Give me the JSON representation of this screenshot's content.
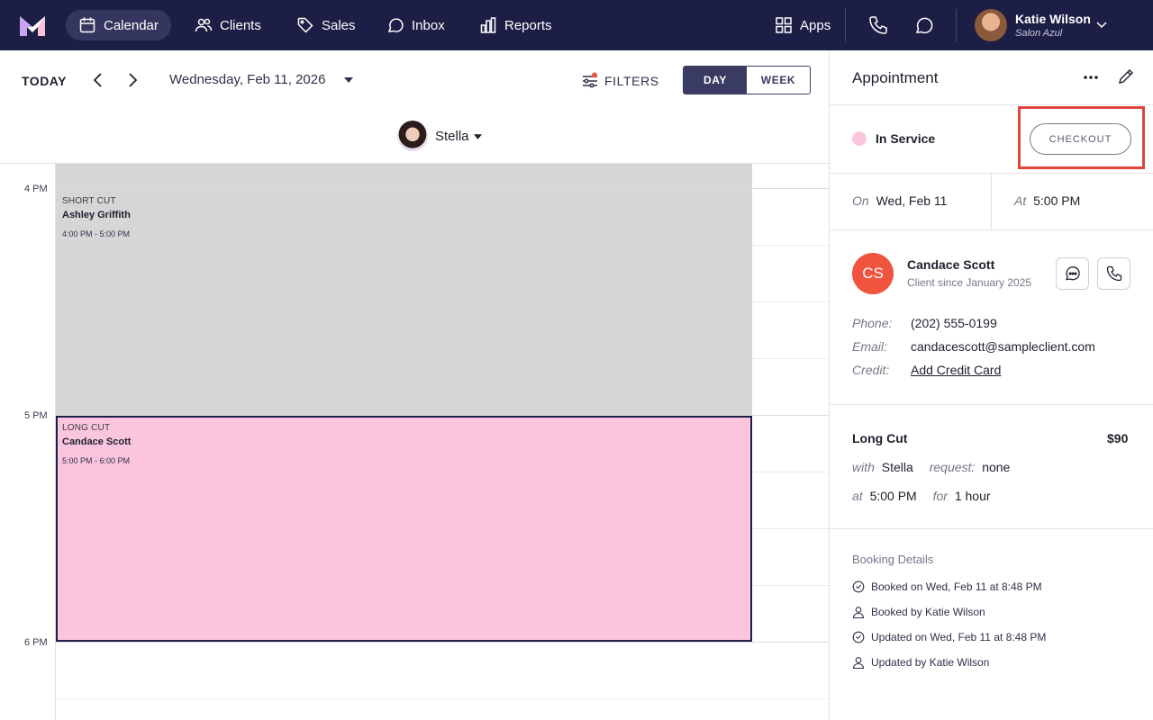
{
  "nav": {
    "items": [
      {
        "label": "Calendar",
        "icon": "calendar-icon",
        "active": true
      },
      {
        "label": "Clients",
        "icon": "clients-icon"
      },
      {
        "label": "Sales",
        "icon": "tag-icon"
      },
      {
        "label": "Inbox",
        "icon": "inbox-icon"
      },
      {
        "label": "Reports",
        "icon": "chart-icon"
      }
    ],
    "apps_label": "Apps",
    "user": {
      "name": "Katie Wilson",
      "salon": "Salon Azul"
    }
  },
  "calendar": {
    "today_label": "TODAY",
    "date": "Wednesday, Feb 11, 2026",
    "filters_label": "FILTERS",
    "view": {
      "day": "DAY",
      "week": "WEEK",
      "selected": "DAY"
    },
    "staff": "Stella",
    "hours": [
      "4 PM",
      "5 PM",
      "6 PM"
    ],
    "appointments": [
      {
        "service": "SHORT CUT",
        "client": "Ashley Griffith",
        "time": "4:00 PM - 5:00 PM",
        "color": "#d6d6d6"
      },
      {
        "service": "LONG CUT",
        "client": "Candace Scott",
        "time": "5:00 PM - 6:00 PM",
        "color": "#fbc6dd",
        "selected": true
      }
    ]
  },
  "panel": {
    "title": "Appointment",
    "status": "In Service",
    "status_color": "#fbc6dd",
    "checkout_label": "CHECKOUT",
    "on_label": "On",
    "on_value": "Wed, Feb 11",
    "at_label": "At",
    "at_value": "5:00 PM",
    "client": {
      "initials": "CS",
      "name": "Candace Scott",
      "since": "Client since January 2025",
      "avatar_color": "#f0533e",
      "phone_label": "Phone:",
      "phone": "(202) 555-0199",
      "email_label": "Email:",
      "email": "candacescott@sampleclient.com",
      "credit_label": "Credit:",
      "credit_link": "Add Credit Card"
    },
    "service": {
      "name": "Long Cut",
      "price": "$90",
      "with_label": "with",
      "with": "Stella",
      "request_label": "request:",
      "request": "none",
      "at_label": "at",
      "at": "5:00 PM",
      "for_label": "for",
      "duration": "1 hour"
    },
    "booking": {
      "title": "Booking Details",
      "rows": [
        {
          "icon": "clock-icon",
          "text": "Booked on Wed, Feb 11 at 8:48 PM"
        },
        {
          "icon": "person-icon",
          "text": "Booked by Katie Wilson"
        },
        {
          "icon": "clock-icon",
          "text": "Updated on Wed, Feb 11 at 8:48 PM"
        },
        {
          "icon": "person-icon",
          "text": "Updated by Katie Wilson"
        }
      ]
    }
  }
}
